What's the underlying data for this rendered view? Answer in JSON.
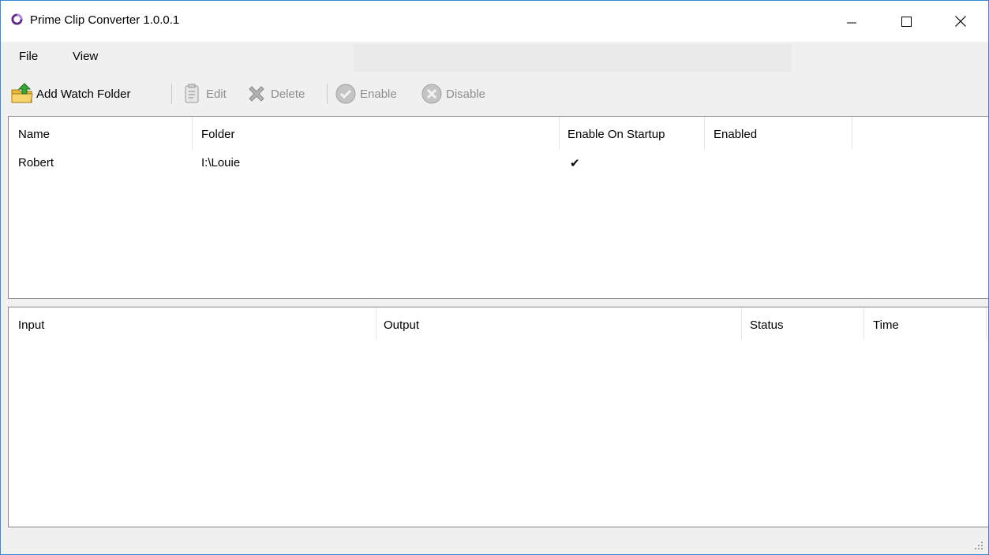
{
  "window": {
    "title": "Prime Clip Converter 1.0.0.1"
  },
  "menu": {
    "file": "File",
    "view": "View"
  },
  "toolbar": {
    "add_watch_folder": "Add Watch Folder",
    "edit": "Edit",
    "delete": "Delete",
    "enable": "Enable",
    "disable": "Disable"
  },
  "watch_folders": {
    "columns": [
      "Name",
      "Folder",
      "Enable On Startup",
      "Enabled"
    ],
    "rows": [
      {
        "name": "Robert",
        "folder": "I:\\Louie",
        "enable_on_startup": "✔",
        "enabled": ""
      }
    ]
  },
  "jobs": {
    "columns": [
      "Input",
      "Output",
      "Status",
      "Time"
    ],
    "rows": []
  },
  "colors": {
    "window_border": "#3c86d6",
    "chrome_bg": "#f0f0f0",
    "disabled_text": "#8d8d8d",
    "app_icon": "#5b2a86"
  },
  "icons": {
    "app": "app-ring-icon",
    "add_watch_folder": "folder-add-icon",
    "edit": "clipboard-edit-icon",
    "delete": "delete-x-icon",
    "enable": "check-circle-icon",
    "disable": "x-circle-icon"
  }
}
